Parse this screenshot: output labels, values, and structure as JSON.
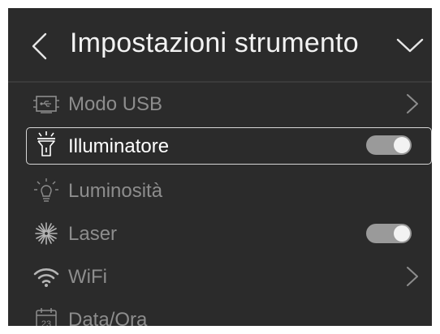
{
  "header": {
    "title": "Impostazioni strumento"
  },
  "menu": [
    {
      "label": "Modo USB",
      "icon": "usb-mode-icon",
      "control": "arrow"
    },
    {
      "label": "Illuminatore",
      "icon": "flashlight-icon",
      "control": "toggle",
      "on": true,
      "selected": true
    },
    {
      "label": "Luminosità",
      "icon": "brightness-bulb-icon",
      "control": "none"
    },
    {
      "label": "Laser",
      "icon": "laser-icon",
      "control": "toggle",
      "on": true
    },
    {
      "label": "WiFi",
      "icon": "wifi-icon",
      "control": "arrow"
    },
    {
      "label": "Data/Ora",
      "icon": "calendar-icon",
      "control": "none",
      "icon_text": "23"
    }
  ],
  "colors": {
    "background": "#2b2b2b",
    "text_selected": "#ffffff",
    "text_normal": "#8d8d8d",
    "toggle_on": "#9a9a9a"
  }
}
